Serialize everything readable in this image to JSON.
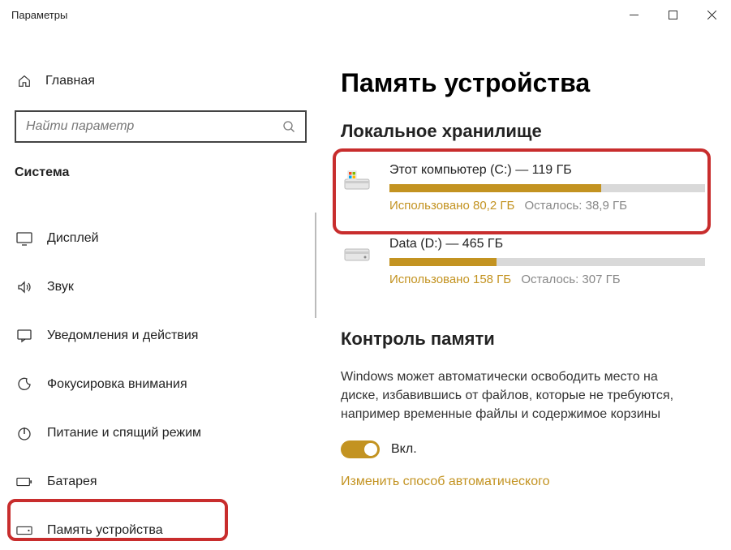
{
  "titlebar": {
    "title": "Параметры"
  },
  "sidebar": {
    "home_label": "Главная",
    "search_placeholder": "Найти параметр",
    "section_title": "Система",
    "items": [
      {
        "label": "Дисплей"
      },
      {
        "label": "Звук"
      },
      {
        "label": "Уведомления и действия"
      },
      {
        "label": "Фокусировка внимания"
      },
      {
        "label": "Питание и спящий режим"
      },
      {
        "label": "Батарея"
      },
      {
        "label": "Память устройства"
      }
    ]
  },
  "main": {
    "title": "Память устройства",
    "local_storage_title": "Локальное хранилище",
    "drives": [
      {
        "name": "Этот компьютер (C:) — 119 ГБ",
        "used_label": "Использовано 80,2 ГБ",
        "free_label": "Осталось: 38,9 ГБ",
        "used_pct": 67
      },
      {
        "name": "Data (D:) — 465 ГБ",
        "used_label": "Использовано 158 ГБ",
        "free_label": "Осталось: 307 ГБ",
        "used_pct": 34
      }
    ],
    "storage_sense": {
      "title": "Контроль памяти",
      "description": "Windows может автоматически освободить место на диске, избавившись от файлов, которые не требуются, например временные файлы и содержимое корзины",
      "toggle_label": "Вкл.",
      "link_text": "Изменить способ автоматического"
    }
  }
}
